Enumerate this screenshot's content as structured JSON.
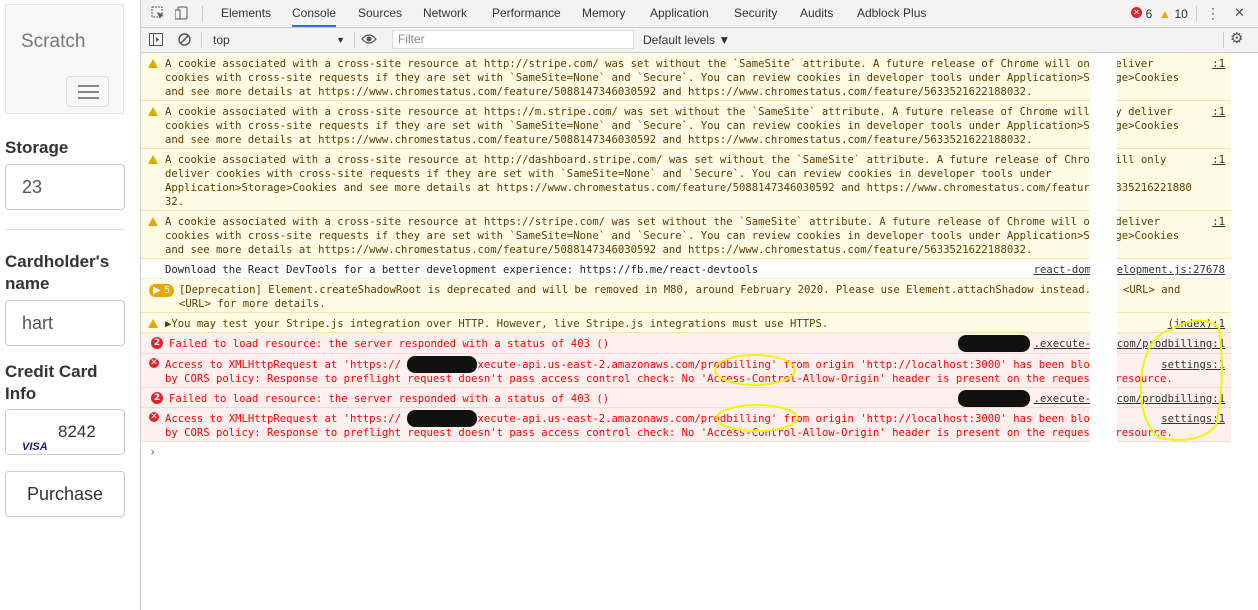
{
  "app": {
    "brand": "Scratch",
    "storage_label": "Storage",
    "storage_value": "23",
    "cardholder_label": "Cardholder's name",
    "cardholder_value": "hart",
    "credit_label": "Credit Card Info",
    "card_brand": "VISA",
    "card_number": "8242",
    "purchase_label": "Purchase"
  },
  "devtools": {
    "tabs": [
      "Elements",
      "Console",
      "Sources",
      "Network",
      "Performance",
      "Memory",
      "Application",
      "Security",
      "Audits",
      "Adblock Plus"
    ],
    "active_tab": "Console",
    "error_count": "6",
    "warning_count": "10",
    "context": "top",
    "filter_placeholder": "Filter",
    "levels": "Default levels ▼",
    "error_color": "#e0242a",
    "warning_color": "#e6a700",
    "accent_color": "#1a73e8"
  },
  "console": {
    "m1": {
      "l1": "A cookie associated with a cross-site resource at http://stripe.com/ was set without the `SameSite` attribute. A future release of Chrome will only deliver",
      "l2": "cookies with cross-site requests if they are set with `SameSite=None` and `Secure`. You can review cookies in developer tools under Application>Storage>Cookies",
      "l3": "and see more details at https://www.chromestatus.com/feature/5088147346030592 and https://www.chromestatus.com/feature/5633521622188032.",
      "src": ":1"
    },
    "m2": {
      "l1": "A cookie associated with a cross-site resource at https://m.stripe.com/ was set without the `SameSite` attribute. A future release of Chrome will only deliver",
      "l2": "cookies with cross-site requests if they are set with `SameSite=None` and `Secure`. You can review cookies in developer tools under Application>Storage>Cookies",
      "l3": "and see more details at https://www.chromestatus.com/feature/5088147346030592 and https://www.chromestatus.com/feature/5633521622188032.",
      "src": ":1"
    },
    "m3": {
      "l1": "A cookie associated with a cross-site resource at http://dashboard.stripe.com/ was set without the `SameSite` attribute. A future release of Chrome will only",
      "l2": "deliver cookies with cross-site requests if they are set with `SameSite=None` and `Secure`. You can review cookies in developer tools under",
      "l3": "Application>Storage>Cookies and see more details at https://www.chromestatus.com/feature/5088147346030592 and https://www.chromestatus.com/feature/56335216221880",
      "l4": "32.",
      "src": ":1"
    },
    "m4": {
      "l1": "A cookie associated with a cross-site resource at https://stripe.com/ was set without the `SameSite` attribute. A future release of Chrome will only deliver",
      "l2": "cookies with cross-site requests if they are set with `SameSite=None` and `Secure`. You can review cookies in developer tools under Application>Storage>Cookies",
      "l3": "and see more details at https://www.chromestatus.com/feature/5088147346030592 and https://www.chromestatus.com/feature/5633521622188032.",
      "src": ":1"
    },
    "m5": {
      "l1": "Download the React DevTools for a better development experience: https://fb.me/react-devtools",
      "src": "react-dom.development.js:27678"
    },
    "m6": {
      "badge": "5",
      "l1": "[Deprecation] Element.createShadowRoot is deprecated and will be removed in M80, around February 2020. Please use Element.attachShadow instead. See <URL> and",
      "l2": "<URL> for more details."
    },
    "m7": {
      "l1": "▶You may test your Stripe.js integration over HTTP. However, live Stripe.js integrations must use HTTPS.",
      "src": "(index):1"
    },
    "m8": {
      "badge": "2",
      "l1": "Failed to load resource: the server responded with a status of 403 ()",
      "src": ".execute-a…s.com/prodbilling:1"
    },
    "m9": {
      "l1": "Access to XMLHttpRequest at 'https://          .execute-api.us-east-2.amazonaws.com/prodbilling' from origin 'http://localhost:3000' has been blocked",
      "l2": "by CORS policy: Response to preflight request doesn't pass access control check: No 'Access-Control-Allow-Origin' header is present on the requested resource.",
      "src": "settings:1"
    },
    "m10": {
      "badge": "2",
      "l1": "Failed to load resource: the server responded with a status of 403 ()",
      "src": ".execute-a…s.com/prodbilling:1"
    },
    "m11": {
      "l1": "Access to XMLHttpRequest at 'https://          .execute-api.us-east-2.amazonaws.com/prodbilling' from origin 'http://localhost:3000' has been blocked",
      "l2": "by CORS policy: Response to preflight request doesn't pass access control check: No 'Access-Control-Allow-Origin' header is present on the requested resource.",
      "src": "settings:1"
    },
    "prompt": "›"
  }
}
